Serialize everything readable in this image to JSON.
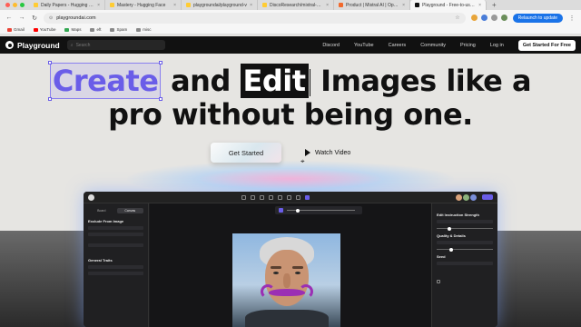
{
  "browser": {
    "tabs": [
      {
        "title": "Daily Papers - Hugging Face",
        "fav_color": "#ffcc33",
        "active": false
      },
      {
        "title": "Mastery - Hugging Face",
        "fav_color": "#ffcc33",
        "active": false
      },
      {
        "title": "playgroundai/playground-v",
        "fav_color": "#ffcc33",
        "active": false
      },
      {
        "title": "DiscoResearch/mixtral-7b-8",
        "fav_color": "#ffcc33",
        "active": false
      },
      {
        "title": "Product | Mistral AI | Open s",
        "fav_color": "#f26a2d",
        "active": false
      },
      {
        "title": "Playground - Free-to-use on",
        "fav_color": "#111111",
        "active": true
      }
    ],
    "new_tab": "+",
    "url": "playgroundai.com",
    "update_label": "Relaunch to update",
    "bookmarks": [
      {
        "label": "Gmail",
        "color": "#ea4335"
      },
      {
        "label": "YouTube",
        "color": "#ff0000"
      },
      {
        "label": "Maps",
        "color": "#34a853"
      },
      {
        "label": "eft",
        "color": "#888888"
      },
      {
        "label": "Spam",
        "color": "#888888"
      },
      {
        "label": "misc",
        "color": "#888888"
      }
    ]
  },
  "site": {
    "brand": "Playground",
    "search_placeholder": "Search",
    "nav": [
      "Discord",
      "YouTube",
      "Careers",
      "Community",
      "Pricing",
      "Log in"
    ],
    "cta": "Get Started For Free"
  },
  "hero": {
    "word_create": "Create",
    "word_and": "and",
    "word_edit": "Edit",
    "line1_rest": "Images like a",
    "line2": "pro without being one.",
    "get_started": "Get Started",
    "watch_video": "Watch Video",
    "accent": "#6a5de8"
  },
  "app_preview": {
    "tab_a": "Board",
    "tab_b": "Canvas",
    "left_h1": "Exclude From Image",
    "left_h2": "General Traits",
    "right_h1": "Edit Instruction Strength",
    "right_h2": "Quality & Details",
    "right_h3": "Seed",
    "mustache_color": "#9b2fb4"
  }
}
